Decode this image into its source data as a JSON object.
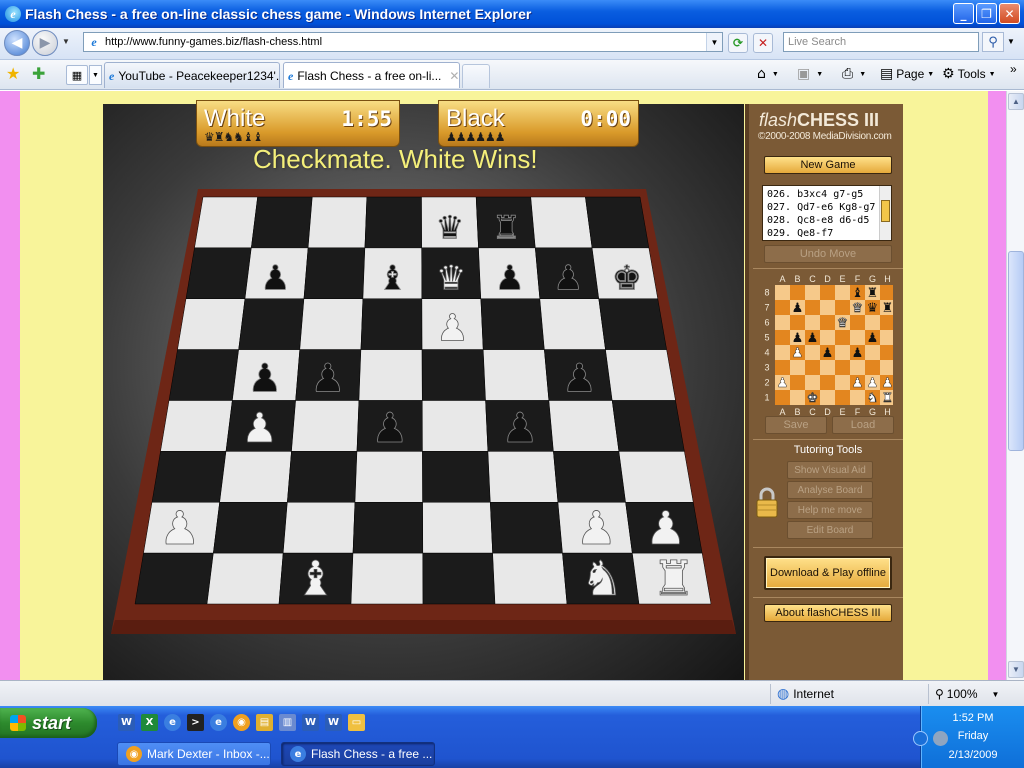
{
  "window": {
    "title": "Flash Chess - a free on-line classic chess game - Windows Internet Explorer",
    "min": "_",
    "max": "❐",
    "close": "✕"
  },
  "address": {
    "url": "http://www.funny-games.biz/flash-chess.html",
    "search_placeholder": "Live Search"
  },
  "tabs": [
    {
      "label": "YouTube - Peacekeeper1234'..."
    },
    {
      "label": "Flash Chess - a free on-li..."
    }
  ],
  "commands": {
    "page": "Page",
    "tools": "Tools"
  },
  "game": {
    "white_label": "White",
    "white_time": "1:55",
    "white_captured": "♛♜♞♞♝♝",
    "black_label": "Black",
    "black_time": "0:00",
    "black_captured": "♟♟♟♟♟♟",
    "status": "Checkmate. White Wins!",
    "board": [
      "....qr..",
      ".p.bQppk",
      "....P...",
      ".pp...p.",
      ".P.p.p..",
      "........",
      "P.....PP",
      "..B...NR"
    ]
  },
  "panel": {
    "logo_italic": "flash",
    "logo_bold": "CHESS III",
    "copyright": "©2000-2008 MediaDivision.com",
    "new_game": "New Game",
    "moves": [
      "026. b3xc4    g7-g5",
      "027. Qd7-e6   Kg8-g7",
      "028. Qc8-e8   d6-d5",
      "029. Qe8-f7"
    ],
    "undo": "Undo Move",
    "files": [
      "A",
      "B",
      "C",
      "D",
      "E",
      "F",
      "G",
      "H"
    ],
    "ranks": [
      "8",
      "7",
      "6",
      "5",
      "4",
      "3",
      "2",
      "1"
    ],
    "mini_board": [
      ".....br.",
      ".p...Qqr",
      "....Q...",
      ".pp...p.",
      ".P.p.p..",
      "........",
      "P....PPP",
      "..K...NR"
    ],
    "save": "Save",
    "load": "Load",
    "tutoring_title": "Tutoring Tools",
    "show_visual_aid": "Show Visual Aid",
    "analyse_board": "Analyse Board",
    "help_me_move": "Help me move",
    "edit_board": "Edit Board",
    "download": "Download & Play offline",
    "about": "About flashCHESS III"
  },
  "statusbar": {
    "zone": "Internet",
    "zoom": "100%"
  },
  "taskbar": {
    "start": "start",
    "buttons": [
      {
        "label": "Mark Dexter - Inbox -..."
      },
      {
        "label": "Flash Chess - a free ..."
      }
    ],
    "time": "1:52 PM",
    "day": "Friday",
    "date": "2/13/2009"
  },
  "colors": {
    "light_square": "#e8e8e8",
    "dark_square": "#1b1b1b",
    "frame": "#7a2a18",
    "panel": "#7b5a36",
    "button": "#f1c257",
    "accent_yellow": "#f4ef7a"
  }
}
